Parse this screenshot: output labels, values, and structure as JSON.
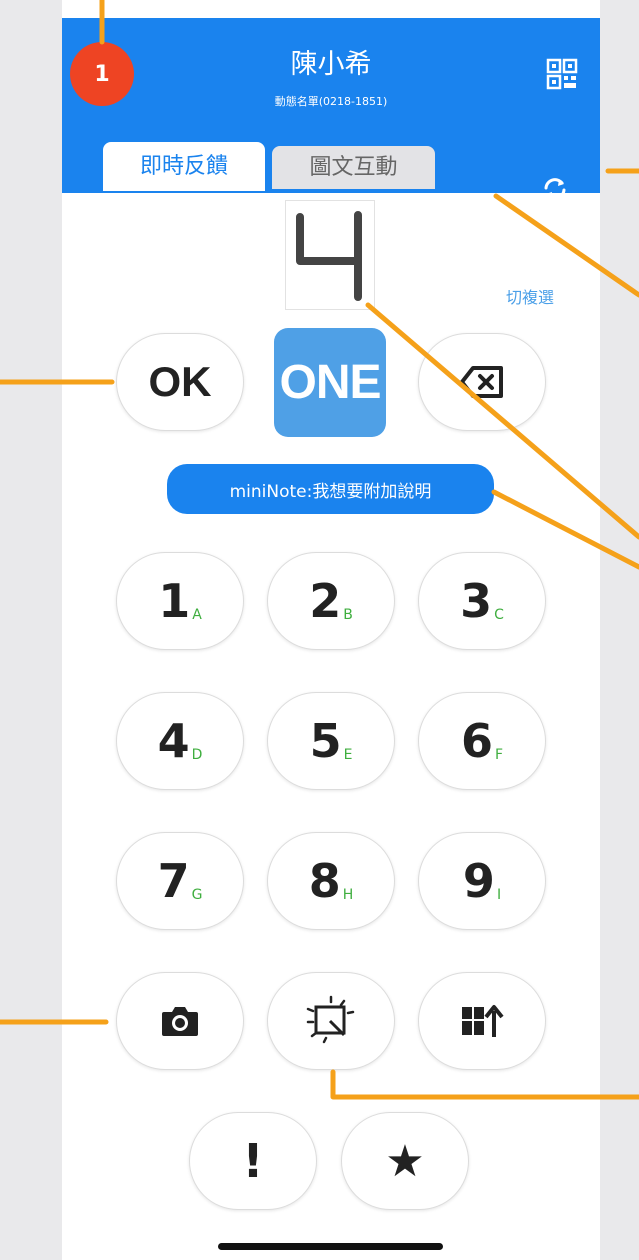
{
  "header": {
    "name": "陳小希",
    "subtitle": "動態名單(0218-1851)",
    "tabs": [
      {
        "label": "即時反饋",
        "active": true
      },
      {
        "label": "圖文互動",
        "active": false
      }
    ]
  },
  "badge": {
    "number": "1"
  },
  "display": {
    "digit": "4",
    "switch_label": "切複選"
  },
  "controls": {
    "ok_label": "OK",
    "one_label": "ONE"
  },
  "mininote": {
    "label": "miniNote:我想要附加說明"
  },
  "keypad": [
    {
      "digit": "1",
      "letter": "A"
    },
    {
      "digit": "2",
      "letter": "B"
    },
    {
      "digit": "3",
      "letter": "C"
    },
    {
      "digit": "4",
      "letter": "D"
    },
    {
      "digit": "5",
      "letter": "E"
    },
    {
      "digit": "6",
      "letter": "F"
    },
    {
      "digit": "7",
      "letter": "G"
    },
    {
      "digit": "8",
      "letter": "H"
    },
    {
      "digit": "9",
      "letter": "I"
    }
  ],
  "bottom": {
    "exclaim_label": "!",
    "star_label": "★"
  },
  "icons": [
    "qrcode-icon",
    "sync-icon",
    "backspace-icon",
    "camera-icon",
    "screenshot-icon",
    "layout-upload-icon"
  ],
  "colors": {
    "primary": "#1a83ee",
    "accent": "#f5a11a",
    "badge": "#ee4423",
    "letter": "#3fae3f"
  }
}
